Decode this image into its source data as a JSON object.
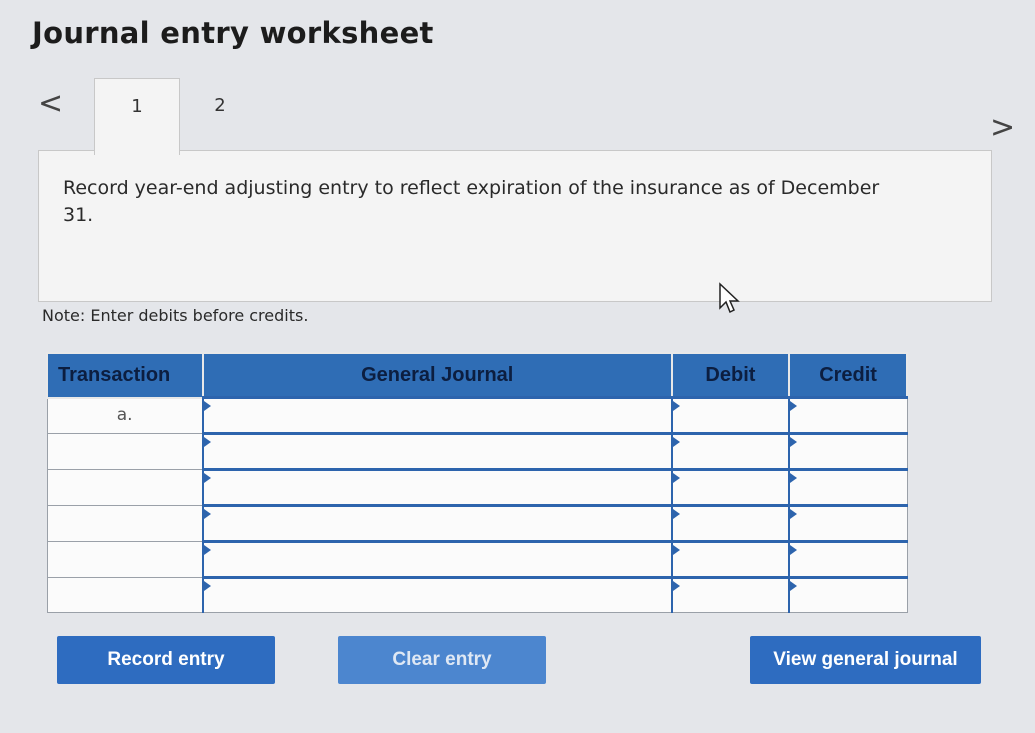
{
  "header": {
    "title": "Journal entry worksheet"
  },
  "nav": {
    "prev": "<",
    "next": ">"
  },
  "tabs": [
    {
      "label": "1"
    },
    {
      "label": "2"
    }
  ],
  "instructions": "Record year-end adjusting entry to reflect expiration of the insurance as of December 31.",
  "note": "Note: Enter debits before credits.",
  "table": {
    "headers": {
      "transaction": "Transaction",
      "general_journal": "General Journal",
      "debit": "Debit",
      "credit": "Credit"
    },
    "rows": [
      {
        "transaction": "a.",
        "account": "",
        "debit": "",
        "credit": ""
      },
      {
        "transaction": "",
        "account": "",
        "debit": "",
        "credit": ""
      },
      {
        "transaction": "",
        "account": "",
        "debit": "",
        "credit": ""
      },
      {
        "transaction": "",
        "account": "",
        "debit": "",
        "credit": ""
      },
      {
        "transaction": "",
        "account": "",
        "debit": "",
        "credit": ""
      },
      {
        "transaction": "",
        "account": "",
        "debit": "",
        "credit": ""
      }
    ]
  },
  "buttons": {
    "record": "Record entry",
    "clear": "Clear entry",
    "view": "View general journal"
  }
}
